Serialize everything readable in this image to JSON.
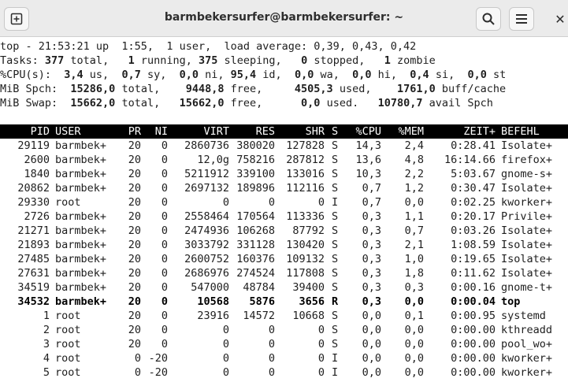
{
  "window": {
    "title": "barmbekersurfer@barmbekersurfer: ~"
  },
  "icons": {
    "new_tab": "new-tab-icon",
    "search": "search-icon",
    "menu": "hamburger-menu-icon",
    "close": "close-icon"
  },
  "summary": {
    "line1": "top - 21:53:21 up  1:55,  1 user,  load average: 0,39, 0,43, 0,42",
    "tasks": {
      "prefix": "Tasks: ",
      "total": "377",
      "total_l": " total,   ",
      "running": "1",
      "running_l": " running, ",
      "sleeping": "375",
      "sleeping_l": " sleeping,   ",
      "stopped": "0",
      "stopped_l": " stopped,   ",
      "zombie": "1",
      "zombie_l": " zombie"
    },
    "cpu": {
      "prefix": "%CPU(s):  ",
      "us": "3,4",
      "us_l": " us,  ",
      "sy": "0,7",
      "sy_l": " sy,  ",
      "ni": "0,0",
      "ni_l": " ni, ",
      "id": "95,4",
      "id_l": " id,  ",
      "wa": "0,0",
      "wa_l": " wa,  ",
      "hi": "0,0",
      "hi_l": " hi,  ",
      "si": "0,4",
      "si_l": " si,  ",
      "st": "0,0",
      "st_l": " st"
    },
    "mem": {
      "prefix": "MiB Spch:  ",
      "total": "15286,0",
      "total_l": " total,    ",
      "free": "9448,8",
      "free_l": " free,     ",
      "used": "4505,3",
      "used_l": " used,    ",
      "buff": "1761,0",
      "buff_l": " buff/cache"
    },
    "swap": {
      "prefix": "MiB Swap:  ",
      "total": "15662,0",
      "total_l": " total,   ",
      "free": "15662,0",
      "free_l": " free,      ",
      "used": "0,0",
      "used_l": " used.   ",
      "avail": "10780,7",
      "avail_l": " avail Spch"
    }
  },
  "columns": [
    "PID",
    "USER",
    "PR",
    "NI",
    "VIRT",
    "RES",
    "SHR",
    "S",
    "%CPU",
    "%MEM",
    "ZEIT+",
    "BEFEHL"
  ],
  "processes": [
    [
      "29119",
      "barmbek+",
      "20",
      "0",
      "2860736",
      "380020",
      "127828",
      "S",
      "14,3",
      "2,4",
      "0:28.41",
      "Isolate+"
    ],
    [
      "2600",
      "barmbek+",
      "20",
      "0",
      "12,0g",
      "758216",
      "287812",
      "S",
      "13,6",
      "4,8",
      "16:14.66",
      "firefox+"
    ],
    [
      "1840",
      "barmbek+",
      "20",
      "0",
      "5211912",
      "339100",
      "133016",
      "S",
      "10,3",
      "2,2",
      "5:03.67",
      "gnome-s+"
    ],
    [
      "20862",
      "barmbek+",
      "20",
      "0",
      "2697132",
      "189896",
      "112116",
      "S",
      "0,7",
      "1,2",
      "0:30.47",
      "Isolate+"
    ],
    [
      "29330",
      "root",
      "20",
      "0",
      "0",
      "0",
      "0",
      "I",
      "0,7",
      "0,0",
      "0:02.25",
      "kworker+"
    ],
    [
      "2726",
      "barmbek+",
      "20",
      "0",
      "2558464",
      "170564",
      "113336",
      "S",
      "0,3",
      "1,1",
      "0:20.17",
      "Privile+"
    ],
    [
      "21271",
      "barmbek+",
      "20",
      "0",
      "2474936",
      "106268",
      "87792",
      "S",
      "0,3",
      "0,7",
      "0:03.26",
      "Isolate+"
    ],
    [
      "21893",
      "barmbek+",
      "20",
      "0",
      "3033792",
      "331128",
      "130420",
      "S",
      "0,3",
      "2,1",
      "1:08.59",
      "Isolate+"
    ],
    [
      "27485",
      "barmbek+",
      "20",
      "0",
      "2600752",
      "160376",
      "109132",
      "S",
      "0,3",
      "1,0",
      "0:19.65",
      "Isolate+"
    ],
    [
      "27631",
      "barmbek+",
      "20",
      "0",
      "2686976",
      "274524",
      "117808",
      "S",
      "0,3",
      "1,8",
      "0:11.62",
      "Isolate+"
    ],
    [
      "34519",
      "barmbek+",
      "20",
      "0",
      "547000",
      "48784",
      "39400",
      "S",
      "0,3",
      "0,3",
      "0:00.16",
      "gnome-t+"
    ],
    [
      "34532",
      "barmbek+",
      "20",
      "0",
      "10568",
      "5876",
      "3656",
      "R",
      "0,3",
      "0,0",
      "0:00.04",
      "top"
    ],
    [
      "1",
      "root",
      "20",
      "0",
      "23916",
      "14572",
      "10668",
      "S",
      "0,0",
      "0,1",
      "0:00.95",
      "systemd"
    ],
    [
      "2",
      "root",
      "20",
      "0",
      "0",
      "0",
      "0",
      "S",
      "0,0",
      "0,0",
      "0:00.00",
      "kthreadd"
    ],
    [
      "3",
      "root",
      "20",
      "0",
      "0",
      "0",
      "0",
      "S",
      "0,0",
      "0,0",
      "0:00.00",
      "pool_wo+"
    ],
    [
      "4",
      "root",
      "0",
      "-20",
      "0",
      "0",
      "0",
      "I",
      "0,0",
      "0,0",
      "0:00.00",
      "kworker+"
    ],
    [
      "5",
      "root",
      "0",
      "-20",
      "0",
      "0",
      "0",
      "I",
      "0,0",
      "0,0",
      "0:00.00",
      "kworker+"
    ]
  ],
  "highlighted_row": 11
}
